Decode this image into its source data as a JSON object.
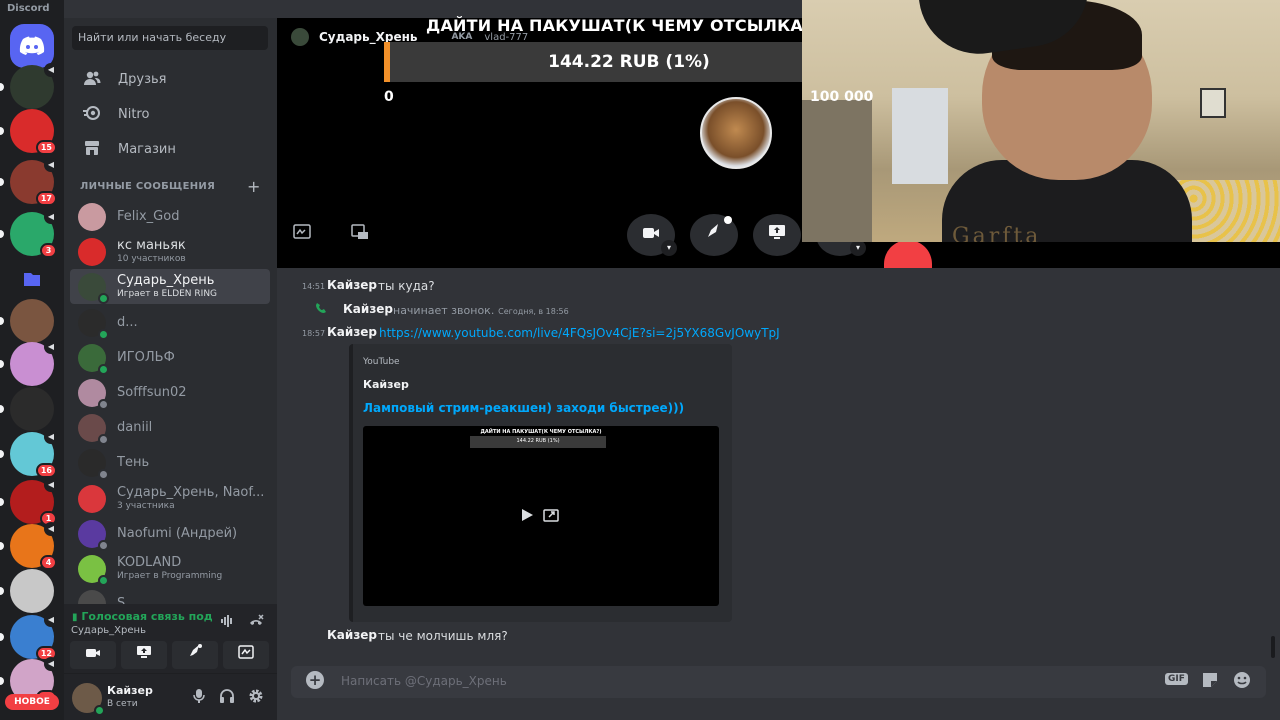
{
  "app": {
    "title": "Discord"
  },
  "servers": {
    "items": [
      {
        "name": "home",
        "color": "#5865f2"
      },
      {
        "name": "server-1",
        "color": "#2f3a2f",
        "speaker": true
      },
      {
        "name": "server-2",
        "color": "#d92b2b",
        "badge": "15"
      },
      {
        "name": "server-3",
        "color": "#8a3a2f",
        "badge": "17",
        "speaker": true
      },
      {
        "name": "server-4",
        "color": "#2aa86a",
        "badge": "3",
        "speaker": true
      },
      {
        "name": "folder",
        "color": "#5865f2"
      },
      {
        "name": "server-5",
        "color": "#7a5540"
      },
      {
        "name": "server-6",
        "color": "#c98fd2",
        "speaker": true
      },
      {
        "name": "server-7",
        "color": "#2b2b2b"
      },
      {
        "name": "server-8",
        "color": "#63c8d6",
        "badge": "16",
        "speaker": true
      },
      {
        "name": "server-9",
        "color": "#b31d1d",
        "badge": "1",
        "speaker": true
      },
      {
        "name": "server-10",
        "color": "#e8751a",
        "badge": "4",
        "speaker": true
      },
      {
        "name": "server-11",
        "color": "#c8c8c8"
      },
      {
        "name": "server-12",
        "color": "#3a7fd0",
        "badge": "12",
        "speaker": true
      },
      {
        "name": "server-13",
        "color": "#d1a4c8",
        "badge": "41",
        "speaker": true
      }
    ],
    "new_label": "НОВОЕ"
  },
  "sidebar": {
    "search_placeholder": "Найти или начать беседу",
    "nav": [
      {
        "label": "Друзья",
        "icon": "friends-icon"
      },
      {
        "label": "Nitro",
        "icon": "nitro-icon"
      },
      {
        "label": "Магазин",
        "icon": "shop-icon"
      }
    ],
    "dm_header": "Личные сообщения",
    "dms": [
      {
        "name": "Felix_God",
        "sub": "",
        "color": "#c99aa0",
        "status": ""
      },
      {
        "name": "кс маньяк",
        "sub": "10 участников",
        "color": "#d92b2b",
        "status": "",
        "bright": true
      },
      {
        "name": "Сударь_Хрень",
        "sub": "Играет в ELDEN RING",
        "color": "#3a4a3a",
        "status": "#23a559",
        "active": true
      },
      {
        "name": "d...",
        "sub": "",
        "color": "#2b2b2b",
        "status": "#23a559"
      },
      {
        "name": "ИГОЛЬФ",
        "sub": "",
        "color": "#3a6a3a",
        "status": "#23a559"
      },
      {
        "name": "Sofffsun02",
        "sub": "",
        "color": "#b08aa0",
        "status": "#80848e"
      },
      {
        "name": "daniil",
        "sub": "",
        "color": "#6a4a4a",
        "status": "#80848e"
      },
      {
        "name": "Тень",
        "sub": "",
        "color": "#2a2a2a",
        "status": "#80848e"
      },
      {
        "name": "Сударь_Хрень, Naof...",
        "sub": "3 участника",
        "color": "#da373c",
        "status": ""
      },
      {
        "name": "Naofumi (Андрей)",
        "sub": "",
        "color": "#5a3aa0",
        "status": "#80848e"
      },
      {
        "name": "KODLAND",
        "sub": "Играет в Programming",
        "color": "#7ac143",
        "status": "#23a559"
      },
      {
        "name": "S...",
        "sub": "",
        "color": "#4a4a4a",
        "status": ""
      }
    ]
  },
  "voice": {
    "status": "Голосовая связь под",
    "channel": "Сударь_Хрень"
  },
  "user": {
    "name": "Кайзер",
    "status": "В сети"
  },
  "call": {
    "name": "Сударь_Хрень",
    "aka_label": "AKA",
    "aka_value": "vlad-777"
  },
  "overlay": {
    "goal_title": "ДАЙТИ НА ПАКУШАТ(К ЧЕМУ ОТСЫЛКА?)",
    "amount": "144.22 RUB (1%)",
    "progress": 0.01,
    "min": "0",
    "max": "100 000",
    "accent": "#f2912a",
    "shirt_text": "Garfta"
  },
  "messages": [
    {
      "time": "14:51",
      "author": "Кайзер",
      "text": "ты куда?"
    },
    {
      "system": true,
      "author": "Кайзер",
      "text": "начинает звонок.",
      "date": "Сегодня, в 18:56"
    },
    {
      "time": "18:57",
      "author": "Кайзер",
      "link": "https://www.youtube.com/live/4FQsJOv4CjE?si=2j5YX68GvJOwyTpJ"
    },
    {
      "author": "Кайзер",
      "text": "ты че молчишь мля?"
    }
  ],
  "embed": {
    "provider": "YouTube",
    "author": "Кайзер",
    "title": "Ламповый стрим-реакшен) заходи быстрее)))",
    "thumb_title": "ДАЙТИ НА ПАКУШАТ(К ЧЕМУ ОТСЫЛКА?)",
    "thumb_amount": "144.22 RUB (1%)"
  },
  "composer": {
    "placeholder": "Написать @Сударь_Хрень",
    "gif_label": "GIF"
  }
}
